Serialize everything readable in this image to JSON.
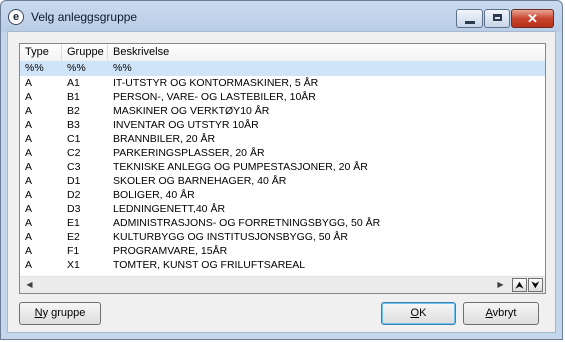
{
  "window": {
    "title": "Velg anleggsgruppe",
    "app_icon": "e",
    "controls": {
      "minimize": "minimize-icon",
      "maximize": "maximize-icon",
      "close": "close-icon"
    }
  },
  "table": {
    "headers": {
      "type": "Type",
      "group": "Gruppe",
      "description": "Beskrivelse"
    },
    "filter": {
      "type": "%%",
      "group": "%%",
      "description": "%%"
    },
    "rows": [
      {
        "type": "A",
        "group": "A1",
        "description": "IT-UTSTYR OG KONTORMASKINER, 5 ÅR"
      },
      {
        "type": "A",
        "group": "B1",
        "description": "PERSON-, VARE- OG LASTEBILER, 10ÅR"
      },
      {
        "type": "A",
        "group": "B2",
        "description": "MASKINER OG VERKTØY10 ÅR"
      },
      {
        "type": "A",
        "group": "B3",
        "description": "INVENTAR OG UTSTYR 10ÅR"
      },
      {
        "type": "A",
        "group": "C1",
        "description": "BRANNBILER, 20 ÅR"
      },
      {
        "type": "A",
        "group": "C2",
        "description": "PARKERINGSPLASSER, 20 ÅR"
      },
      {
        "type": "A",
        "group": "C3",
        "description": "TEKNISKE ANLEGG OG PUMPESTASJONER, 20 ÅR"
      },
      {
        "type": "A",
        "group": "D1",
        "description": "SKOLER OG BARNEHAGER, 40 ÅR"
      },
      {
        "type": "A",
        "group": "D2",
        "description": "BOLIGER, 40 ÅR"
      },
      {
        "type": "A",
        "group": "D3",
        "description": "LEDNINGENETT,40 ÅR"
      },
      {
        "type": "A",
        "group": "E1",
        "description": "ADMINISTRASJONS- OG FORRETNINGSBYGG, 50 ÅR"
      },
      {
        "type": "A",
        "group": "E2",
        "description": "KULTURBYGG OG INSTITUSJONSBYGG, 50 ÅR"
      },
      {
        "type": "A",
        "group": "F1",
        "description": "PROGRAMVARE, 15ÅR"
      },
      {
        "type": "A",
        "group": "X1",
        "description": "TOMTER, KUNST OG FRILUFTSAREAL"
      }
    ]
  },
  "scroll": {
    "left": "◀",
    "right": "▶",
    "up": "⮝",
    "down": "⮟"
  },
  "buttons": {
    "new_group": {
      "pre": "",
      "u": "N",
      "post": "y gruppe"
    },
    "ok": {
      "pre": "",
      "u": "O",
      "post": "K"
    },
    "cancel": {
      "pre": "",
      "u": "A",
      "post": "vbryt"
    }
  },
  "colors": {
    "selected_row": "#cfe3f9",
    "close_button": "#c7452d",
    "default_button_border": "#3c7fb1"
  }
}
